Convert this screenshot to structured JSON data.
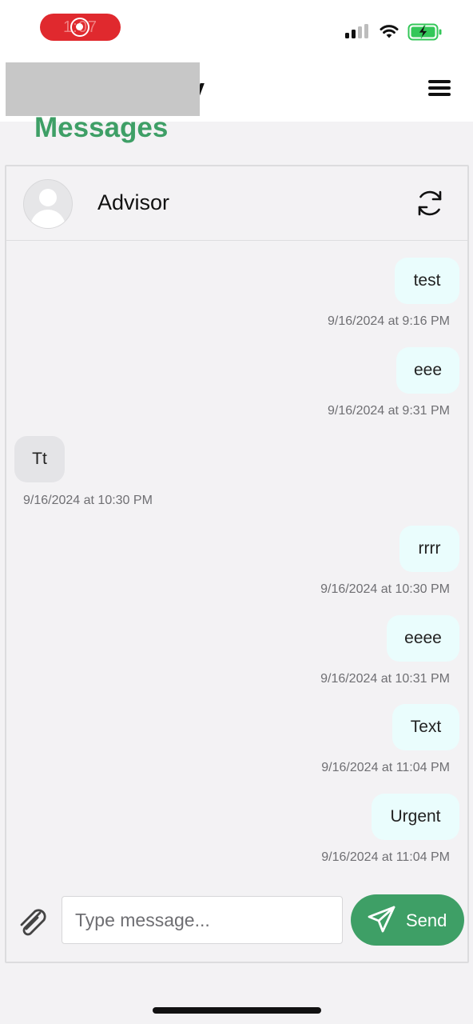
{
  "status_bar": {
    "time": "1:07",
    "recording_color": "#e0292e",
    "icons": [
      "record-icon",
      "cellular-signal-icon",
      "wifi-icon",
      "battery-charging-icon"
    ]
  },
  "header": {
    "brand_tail": "y",
    "menu_icon": "hamburger-menu-icon"
  },
  "page": {
    "title": "Messages",
    "accent_color": "#3e9f66"
  },
  "chat": {
    "contact_name": "Advisor",
    "messages": [
      {
        "direction": "outgoing",
        "text": "test",
        "timestamp": "9/16/2024 at 9:16 PM"
      },
      {
        "direction": "outgoing",
        "text": "eee",
        "timestamp": "9/16/2024 at 9:31 PM"
      },
      {
        "direction": "incoming",
        "text": "Tt",
        "timestamp": "9/16/2024 at 10:30 PM"
      },
      {
        "direction": "outgoing",
        "text": "rrrr",
        "timestamp": "9/16/2024 at 10:30 PM"
      },
      {
        "direction": "outgoing",
        "text": "eeee",
        "timestamp": "9/16/2024 at 10:31 PM"
      },
      {
        "direction": "outgoing",
        "text": "Text",
        "timestamp": "9/16/2024 at 11:04 PM"
      },
      {
        "direction": "outgoing",
        "text": "Urgent",
        "timestamp": "9/16/2024 at 11:04 PM"
      }
    ],
    "outgoing_bubble_color": "#eafdfd",
    "incoming_bubble_color": "#e4e4e7"
  },
  "composer": {
    "placeholder": "Type message...",
    "value": "",
    "send_label": "Send"
  }
}
